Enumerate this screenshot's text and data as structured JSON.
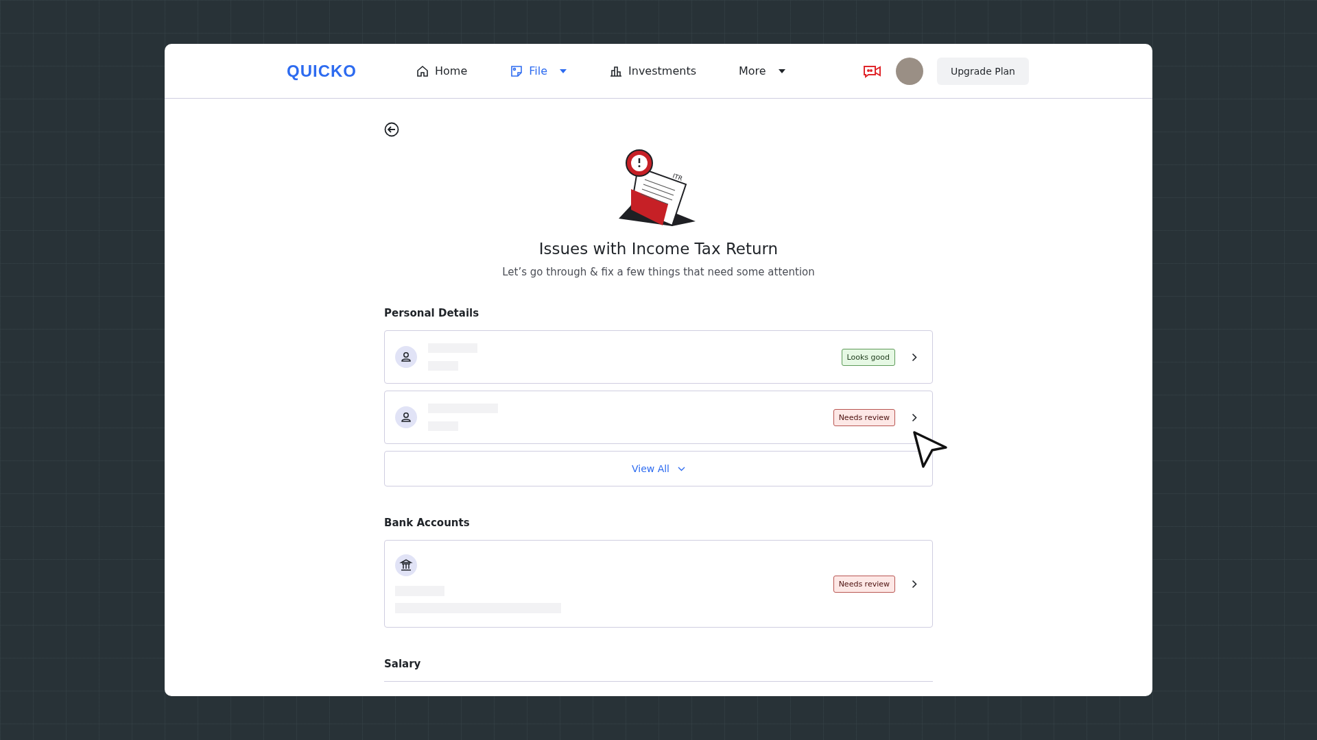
{
  "nav": {
    "logo": "QUICKO",
    "items": [
      {
        "label": "Home",
        "selected": false,
        "dropdown": false
      },
      {
        "label": "File",
        "selected": true,
        "dropdown": true
      },
      {
        "label": "Investments",
        "selected": false,
        "dropdown": false
      },
      {
        "label": "More",
        "selected": false,
        "dropdown": true
      }
    ],
    "upgrade_button": "Upgrade Plan"
  },
  "page": {
    "illustration_label": "ITR",
    "title": "Issues with Income Tax Return",
    "subtitle": "Let’s go through & fix a few things that need some attention"
  },
  "sections": [
    {
      "title": "Personal Details",
      "cards": [
        {
          "kind": "person",
          "status": {
            "kind": "good",
            "label": "Looks good"
          }
        },
        {
          "kind": "person",
          "status": {
            "kind": "review",
            "label": "Needs review"
          }
        }
      ],
      "view_all": "View All"
    },
    {
      "title": "Bank Accounts",
      "cards": [
        {
          "kind": "bank",
          "status": {
            "kind": "review",
            "label": "Needs review"
          }
        }
      ]
    },
    {
      "title": "Salary"
    }
  ]
}
